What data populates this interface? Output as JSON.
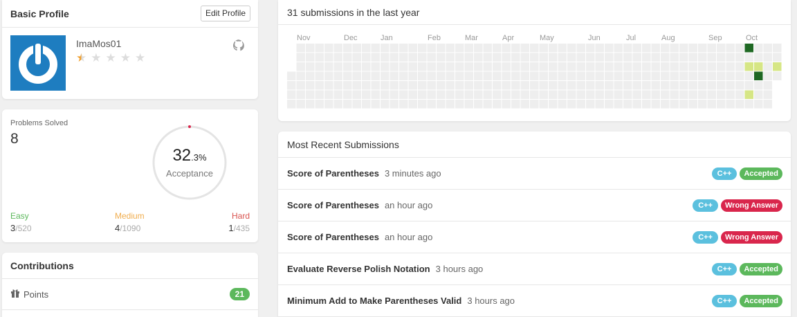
{
  "profile": {
    "title": "Basic Profile",
    "edit_label": "Edit Profile",
    "username": "ImaMos01",
    "rating": 0.5,
    "max_rating": 5
  },
  "problems": {
    "label": "Problems Solved",
    "count": "8",
    "acceptance_int": "32",
    "acceptance_dec": ".3%",
    "acceptance_label": "Acceptance",
    "acceptance_fraction": 0.323,
    "easy": {
      "label": "Easy",
      "solved": "3",
      "total": "/520"
    },
    "medium": {
      "label": "Medium",
      "solved": "4",
      "total": "/1090"
    },
    "hard": {
      "label": "Hard",
      "solved": "1",
      "total": "/435"
    }
  },
  "contributions": {
    "title": "Contributions",
    "points_label": "Points",
    "points_value": "21"
  },
  "heatmap": {
    "title": "31 submissions in the last year",
    "months": [
      "Nov",
      "Dec",
      "Jan",
      "Feb",
      "Mar",
      "Apr",
      "May",
      "Jun",
      "Jul",
      "Aug",
      "Sep",
      "Oct"
    ],
    "weeks": 52,
    "colors": {
      "empty": "#eeeeee",
      "light": "#d6e685",
      "dark": "#1e6823"
    },
    "active_cells": [
      {
        "week": 49,
        "day": 0,
        "level": "dark"
      },
      {
        "week": 49,
        "day": 2,
        "level": "light"
      },
      {
        "week": 50,
        "day": 2,
        "level": "light"
      },
      {
        "week": 52,
        "day": 2,
        "level": "light"
      },
      {
        "week": 50,
        "day": 3,
        "level": "dark"
      },
      {
        "week": 49,
        "day": 5,
        "level": "light"
      }
    ]
  },
  "submissions": {
    "title": "Most Recent Submissions",
    "items": [
      {
        "title": "Score of Parentheses",
        "time": "3 minutes ago",
        "lang": "C++",
        "status": "Accepted",
        "status_type": "acc"
      },
      {
        "title": "Score of Parentheses",
        "time": "an hour ago",
        "lang": "C++",
        "status": "Wrong Answer",
        "status_type": "wa"
      },
      {
        "title": "Score of Parentheses",
        "time": "an hour ago",
        "lang": "C++",
        "status": "Wrong Answer",
        "status_type": "wa"
      },
      {
        "title": "Evaluate Reverse Polish Notation",
        "time": "3 hours ago",
        "lang": "C++",
        "status": "Accepted",
        "status_type": "acc"
      },
      {
        "title": "Minimum Add to Make Parentheses Valid",
        "time": "3 hours ago",
        "lang": "C++",
        "status": "Accepted",
        "status_type": "acc"
      }
    ]
  }
}
